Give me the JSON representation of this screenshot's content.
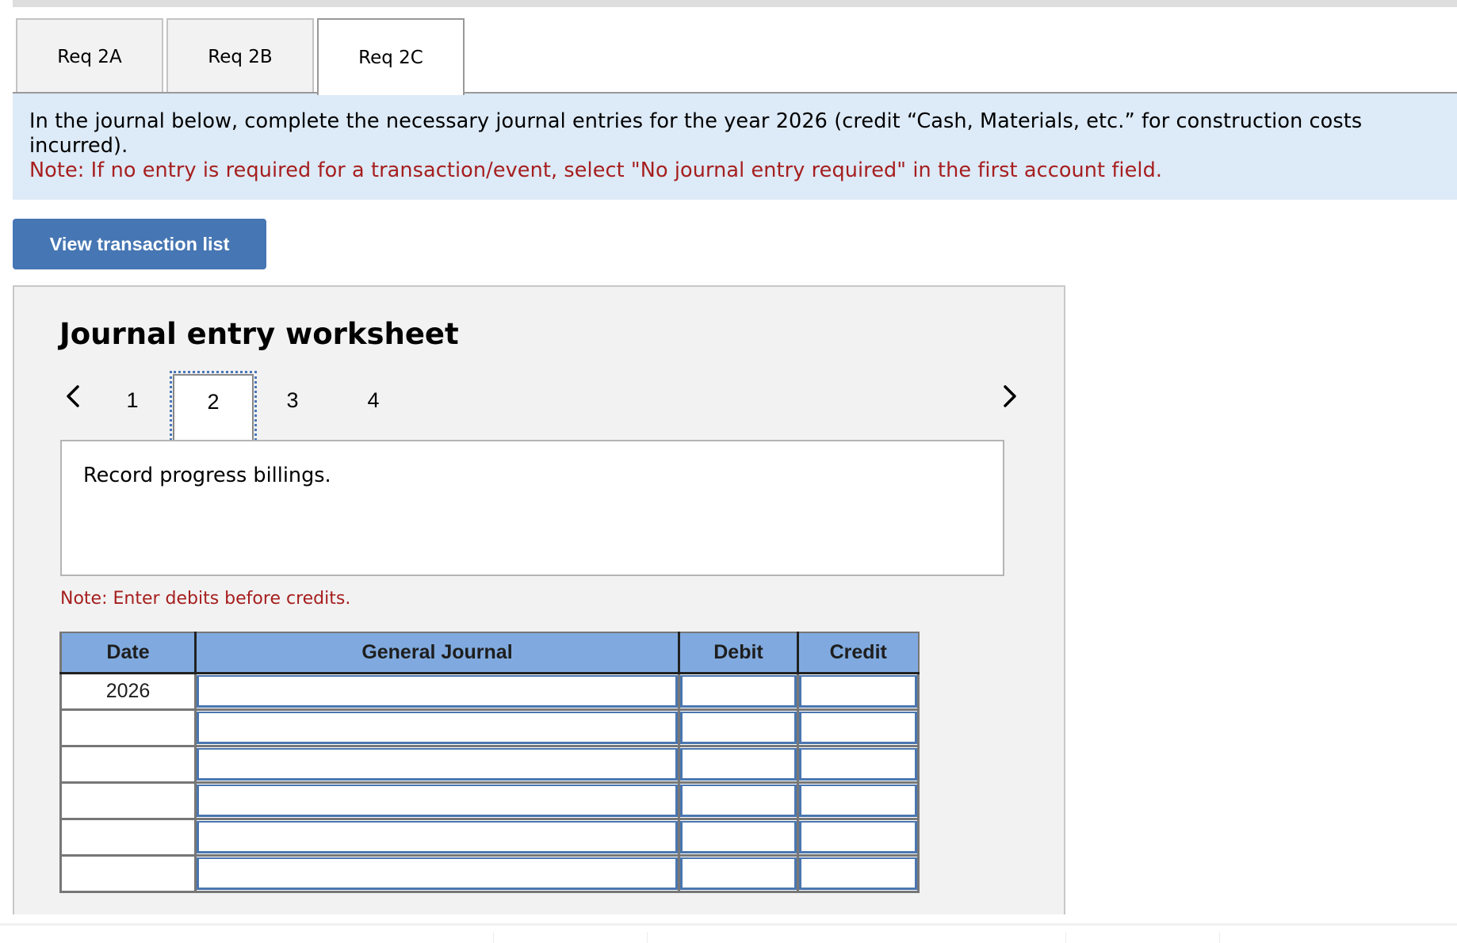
{
  "tabs": [
    {
      "label": "Req 2A",
      "active": false
    },
    {
      "label": "Req 2B",
      "active": false
    },
    {
      "label": "Req 2C",
      "active": true
    }
  ],
  "instructions": {
    "text": "In the journal below, complete the necessary journal entries for the year 2026 (credit “Cash, Materials, etc.” for construction costs incurred).",
    "note": "Note: If no entry is required for a transaction/event, select \"No journal entry required\" in the first account field."
  },
  "view_transaction_button": "View transaction list",
  "worksheet": {
    "title": "Journal entry worksheet",
    "prev_icon": "chevron-left-icon",
    "next_icon": "chevron-right-icon",
    "pages": [
      "1",
      "2",
      "3",
      "4"
    ],
    "current_page": "2",
    "description": "Record progress billings.",
    "entry_note": "Note: Enter debits before credits.",
    "table": {
      "headers": [
        "Date",
        "General Journal",
        "Debit",
        "Credit"
      ],
      "rows": [
        {
          "date": "2026",
          "account": "",
          "debit": "",
          "credit": ""
        },
        {
          "date": "",
          "account": "",
          "debit": "",
          "credit": ""
        },
        {
          "date": "",
          "account": "",
          "debit": "",
          "credit": ""
        },
        {
          "date": "",
          "account": "",
          "debit": "",
          "credit": ""
        },
        {
          "date": "",
          "account": "",
          "debit": "",
          "credit": ""
        },
        {
          "date": "",
          "account": "",
          "debit": "",
          "credit": ""
        }
      ]
    }
  }
}
